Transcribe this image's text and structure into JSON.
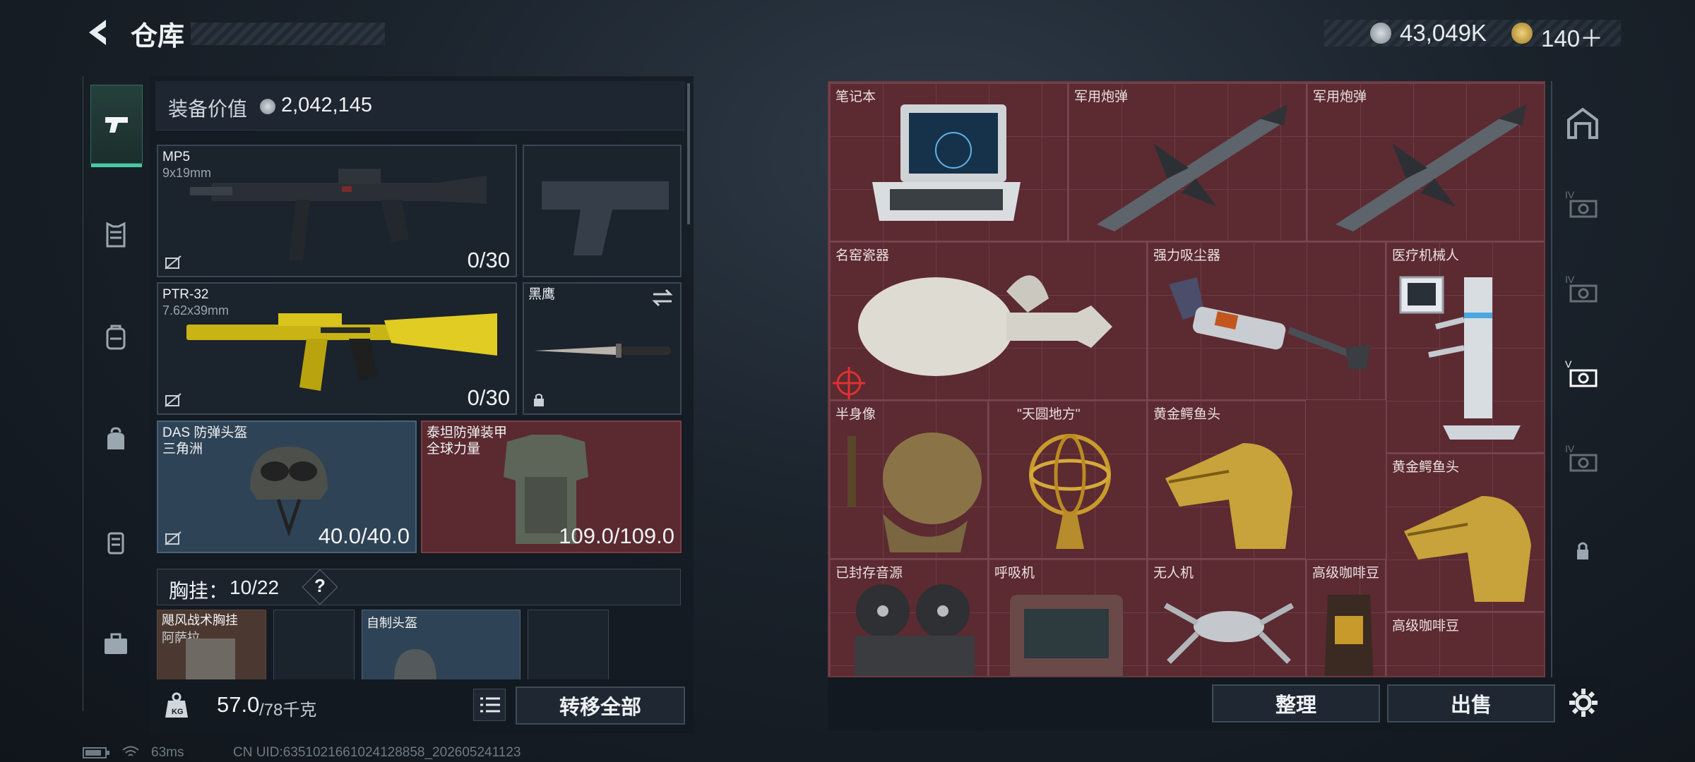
{
  "header": {
    "title": "仓库"
  },
  "currency": {
    "silver": "43,049K",
    "gold": "140＋"
  },
  "rail_tabs": [
    "weapons",
    "armor",
    "backpack",
    "bag",
    "case",
    "toolbox"
  ],
  "equipment": {
    "value_label": "装备价值",
    "value": "2,042,145",
    "primary": {
      "name": "MP5",
      "caliber": "9x19mm",
      "ammo": "0/30"
    },
    "secondary": {
      "name": "PTR-32",
      "caliber": "7.62x39mm",
      "ammo": "0/30"
    },
    "melee": {
      "name": "黑鹰"
    },
    "helmet": {
      "name": "DAS 防弹头盔",
      "sub": "三角洲",
      "durability": "40.0/40.0"
    },
    "armor": {
      "name": "泰坦防弹装甲",
      "sub": "全球力量",
      "durability": "109.0/109.0"
    },
    "chest_rig": {
      "label": "胸挂：",
      "count": "10/22",
      "help": "?"
    },
    "rig_items": [
      {
        "name": "飓风战术胸挂",
        "sub": "阿萨拉"
      },
      {
        "name": "自制头盔"
      }
    ],
    "weight": "57.0",
    "weight_max": "/78千克",
    "transfer_all": "转移全部"
  },
  "storage": {
    "items": [
      {
        "label": "笔记本"
      },
      {
        "label": "军用炮弹"
      },
      {
        "label": "军用炮弹"
      },
      {
        "label": "名窑瓷器"
      },
      {
        "label": "强力吸尘器"
      },
      {
        "label": "医疗机械人"
      },
      {
        "label": "半身像"
      },
      {
        "label": "\"天圆地方\""
      },
      {
        "label": "黄金鳄鱼头"
      },
      {
        "label": "黄金鳄鱼头"
      },
      {
        "label": "已封存音源"
      },
      {
        "label": "呼吸机"
      },
      {
        "label": "无人机"
      },
      {
        "label": "高级咖啡豆"
      },
      {
        "label": "高级咖啡豆"
      }
    ],
    "organize": "整理",
    "sell": "出售"
  },
  "status_bar": {
    "ping": "63ms",
    "uid": "CN UID:6351021661024128858_202605241123"
  },
  "colors": {
    "accent": "#49c7a2",
    "storage_red": "#5c2a31",
    "helmet_blue": "#2f4356"
  }
}
